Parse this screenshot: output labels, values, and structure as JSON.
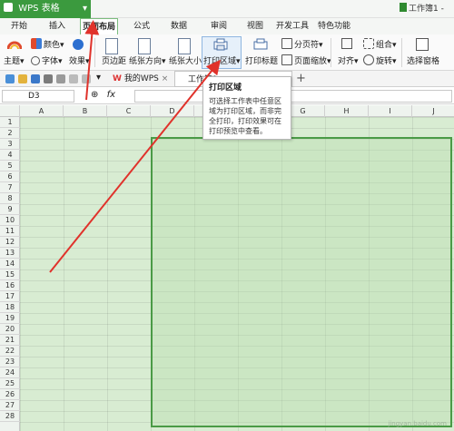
{
  "app": {
    "name": "WPS 表格",
    "document_title": "工作簿1 - "
  },
  "menu": {
    "tabs": [
      {
        "label": "开始"
      },
      {
        "label": "插入"
      },
      {
        "label": "页面布局",
        "active": true
      },
      {
        "label": "公式"
      },
      {
        "label": "数据"
      },
      {
        "label": "审阅"
      },
      {
        "label": "视图"
      },
      {
        "label": "开发工具"
      },
      {
        "label": "特色功能"
      }
    ]
  },
  "ribbon": {
    "theme_label": "主题",
    "colors_label": "颜色",
    "fonts_label": "字体",
    "effects_label": "效果",
    "margins_label": "页边距",
    "orientation_label": "纸张方向",
    "size_label": "纸张大小",
    "print_area_label": "打印区域",
    "print_titles_label": "打印标题",
    "page_break_label": "分页符",
    "page_zoom_label": "页面缩放",
    "align_label": "对齐",
    "group_label": "组合",
    "rotate_label": "旋转",
    "select_pane_label": "选择窗格"
  },
  "qat": {
    "doc_tab1": "我的WPS",
    "doc_tab2": "工作簿1"
  },
  "formula_bar": {
    "name_box": "D3",
    "fx_label": "fx",
    "value": ""
  },
  "grid": {
    "columns": [
      "A",
      "B",
      "C",
      "D",
      "E",
      "F",
      "G",
      "H",
      "I",
      "J"
    ],
    "rows": [
      "1",
      "2",
      "3",
      "4",
      "5",
      "6",
      "7",
      "8",
      "9",
      "10",
      "11",
      "12",
      "13",
      "14",
      "15",
      "16",
      "17",
      "18",
      "19",
      "20",
      "21",
      "22",
      "23",
      "24",
      "25",
      "26",
      "27",
      "28"
    ]
  },
  "tooltip": {
    "title": "打印区域",
    "body": "可选择工作表中任意区域为打印区域，而非完全打印，打印效果可在打印预览中查看。"
  },
  "watermark": "jingyan.baidu.com",
  "colors": {
    "accent": "#3b9a3e",
    "arrow": "#e0322b",
    "print_border": "#4a9a46"
  }
}
